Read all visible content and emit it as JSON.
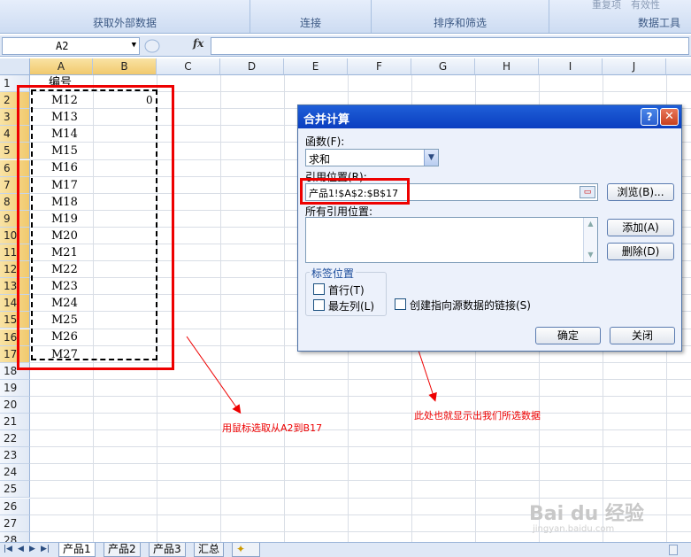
{
  "ribbon": {
    "groups": [
      "获取外部数据",
      "连接",
      "排序和筛选",
      "数据工具"
    ],
    "faded_items": [
      "重复项",
      "有效性"
    ]
  },
  "formula_bar": {
    "name_box": "A2",
    "fx": "fx",
    "formula": ""
  },
  "columns": [
    "A",
    "B",
    "C",
    "D",
    "E",
    "F",
    "G",
    "H",
    "I",
    "J"
  ],
  "rows": [
    "1",
    "2",
    "3",
    "4",
    "5",
    "6",
    "7",
    "8",
    "9",
    "10",
    "11",
    "12",
    "13",
    "14",
    "15",
    "16",
    "17",
    "18",
    "19",
    "20",
    "21",
    "22",
    "23",
    "24",
    "25",
    "26",
    "27",
    "28"
  ],
  "cells": {
    "a1": "编号",
    "b2": "0",
    "a_values": [
      "M12",
      "M13",
      "M14",
      "M15",
      "M16",
      "M17",
      "M18",
      "M19",
      "M20",
      "M21",
      "M22",
      "M23",
      "M24",
      "M25",
      "M26",
      "M27"
    ]
  },
  "dialog": {
    "title": "合并计算",
    "help": "?",
    "close": "✕",
    "function_label": "函数(F):",
    "function_value": "求和",
    "reference_label": "引用位置(R):",
    "reference_value": "产品1!$A$2:$B$17",
    "browse_button": "浏览(B)...",
    "all_references_label": "所有引用位置:",
    "add_button": "添加(A)",
    "delete_button": "删除(D)",
    "label_group_title": "标签位置",
    "top_row_label": "首行(T)",
    "left_column_label": "最左列(L)",
    "link_label": "创建指向源数据的链接(S)",
    "ok_button": "确定",
    "close_button": "关闭"
  },
  "annotations": {
    "left": "用鼠标选取从A2到B17",
    "right": "此处也就显示出我们所选数据"
  },
  "sheet_tabs": [
    "产品1",
    "产品2",
    "产品3",
    "汇总"
  ],
  "active_tab_index": 0,
  "watermark": "Bai du 经验",
  "watermark_sub": "jingyan.baidu.com"
}
